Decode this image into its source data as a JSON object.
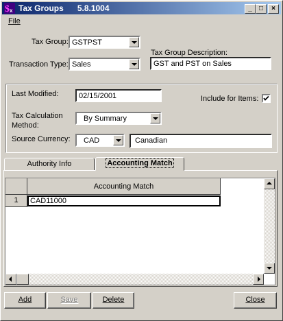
{
  "window": {
    "title": "Tax Groups",
    "version": "5.8.1004",
    "controls": {
      "minimize": "_",
      "maximize": "□",
      "close": "×"
    }
  },
  "menu": {
    "file": "File"
  },
  "header": {
    "tax_group_label": "Tax Group:",
    "tax_group_value": "GSTPST",
    "transaction_type_label": "Transaction Type:",
    "transaction_type_value": "Sales",
    "description_label": "Tax Group Description:",
    "description_value": "GST and PST on Sales"
  },
  "details": {
    "last_modified_label": "Last Modified:",
    "last_modified_value": "02/15/2001",
    "include_items_label": "Include for Items:",
    "include_items_checked": true,
    "calc_method_label_1": "Tax Calculation",
    "calc_method_label_2": "Method:",
    "calc_method_value": "By Summary",
    "source_currency_label": "Source Currency:",
    "source_currency_code": "CAD",
    "source_currency_name": "Canadian"
  },
  "tabs": [
    {
      "label": "Authority Info",
      "active": false
    },
    {
      "label": "Accounting Match",
      "active": true
    }
  ],
  "grid": {
    "columns": [
      "Accounting Match"
    ],
    "rows": [
      {
        "num": "1",
        "value": "CAD11000"
      }
    ]
  },
  "buttons": {
    "add": "Add",
    "save": "Save",
    "delete": "Delete",
    "close": "Close"
  },
  "colors": {
    "titlebar_start": "#0a246a",
    "titlebar_end": "#a6caf0",
    "face": "#d4d0c8"
  }
}
